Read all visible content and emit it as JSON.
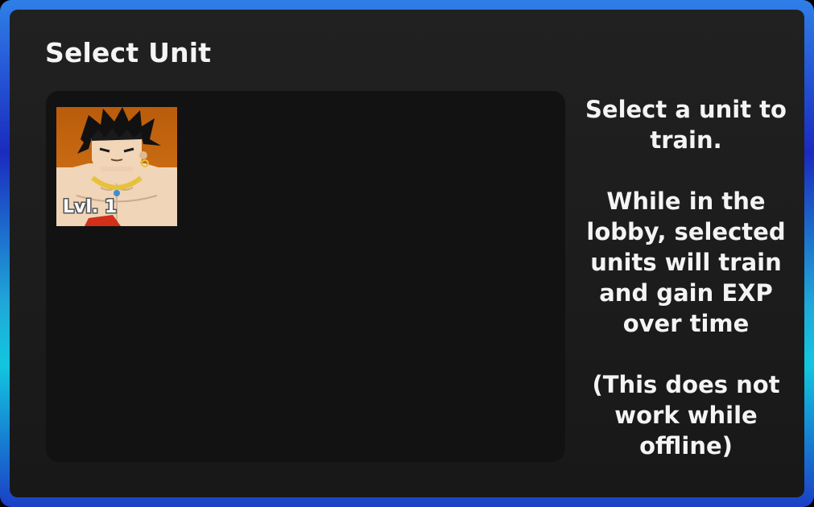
{
  "window": {
    "title": "Select Unit",
    "border_colors": [
      "#2f7fe8",
      "#1a2bbf",
      "#12c6df"
    ]
  },
  "units": [
    {
      "name_icon": "unit-portrait-icon",
      "level_label": "Lvl. 1",
      "portrait_bg": "#c96a12"
    }
  ],
  "info": {
    "line1": "Select a unit to train.",
    "line2": "While in the lobby, selected units will train and gain EXP over time",
    "line3": "(This does not work while offline)"
  }
}
